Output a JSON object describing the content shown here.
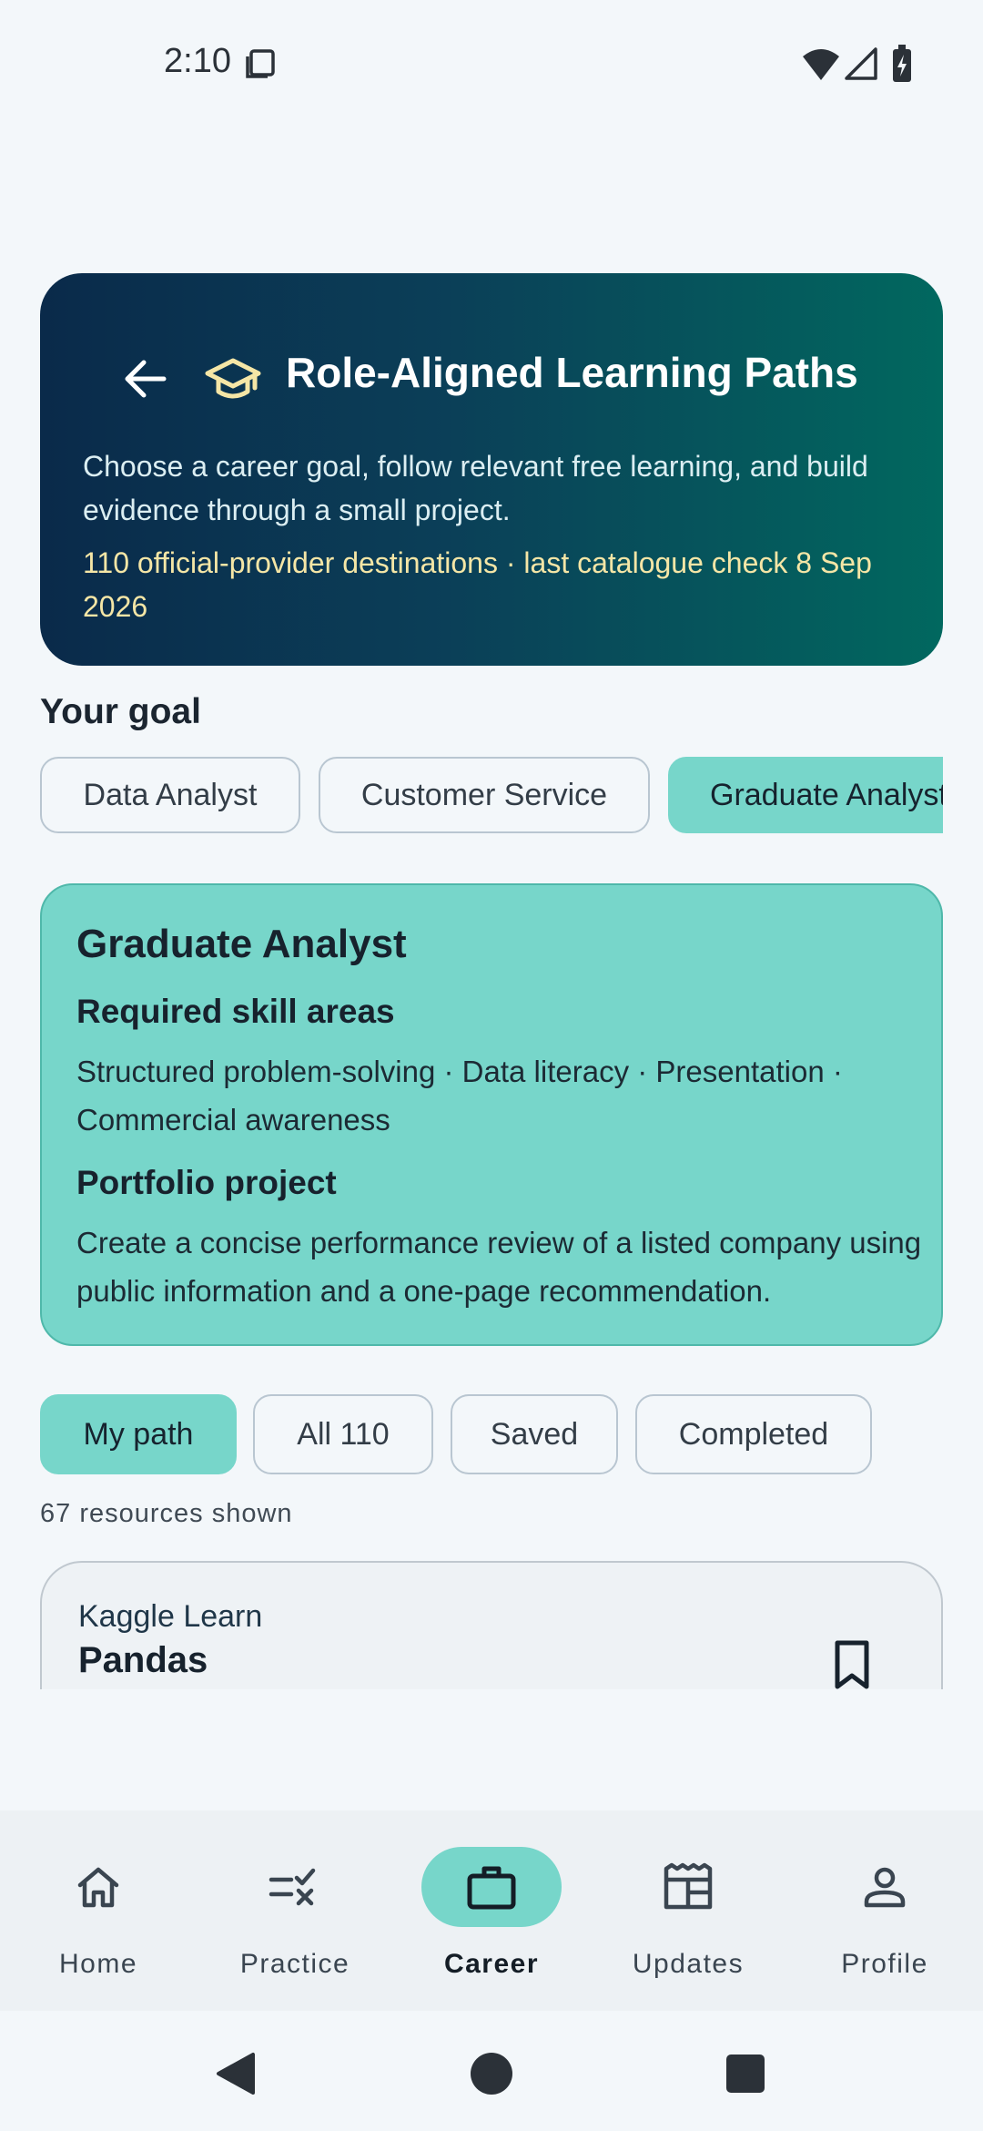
{
  "status_bar": {
    "time": "2:10"
  },
  "header": {
    "title": "Role-Aligned Learning Paths",
    "description": "Choose a career goal, follow relevant free learning, and build evidence through a small project.",
    "meta": "110 official-provider destinations · last catalogue check 8 Sep 2026"
  },
  "goal": {
    "label": "Your goal",
    "options": [
      "Data Analyst",
      "Customer Service",
      "Graduate Analyst"
    ],
    "selected": "Graduate Analyst"
  },
  "goal_card": {
    "title": "Graduate Analyst",
    "skills_heading": "Required skill areas",
    "skills": "Structured problem-solving · Data literacy · Presentation · Commercial awareness",
    "project_heading": "Portfolio project",
    "project": "Create a concise performance review of a listed company using public information and a one-page recommendation."
  },
  "filters": {
    "tabs": [
      "My path",
      "All 110",
      "Saved",
      "Completed"
    ],
    "selected": "My path",
    "count_text": "67 resources shown"
  },
  "resources": [
    {
      "provider": "Kaggle Learn",
      "title": "Pandas",
      "icon": "bookmark-icon"
    }
  ],
  "bottom_nav": {
    "items": [
      {
        "label": "Home",
        "icon": "home-icon"
      },
      {
        "label": "Practice",
        "icon": "practice-icon"
      },
      {
        "label": "Career",
        "icon": "briefcase-icon"
      },
      {
        "label": "Updates",
        "icon": "newspaper-icon"
      },
      {
        "label": "Profile",
        "icon": "person-icon"
      }
    ],
    "active": "Career"
  },
  "colors": {
    "accent": "#77d6ca",
    "hero_start": "#0a2a4a",
    "hero_end": "#01685f",
    "meta_text": "#f5e6a6"
  }
}
